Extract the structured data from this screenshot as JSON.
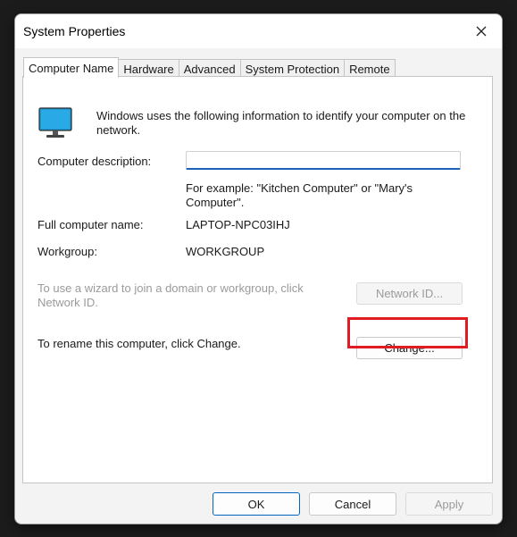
{
  "window": {
    "title": "System Properties"
  },
  "tabs": [
    {
      "label": "Computer Name",
      "active": true
    },
    {
      "label": "Hardware"
    },
    {
      "label": "Advanced"
    },
    {
      "label": "System Protection"
    },
    {
      "label": "Remote"
    }
  ],
  "panel": {
    "intro_text": "Windows uses the following information to identify your computer on the network.",
    "description_label": "Computer description:",
    "description_value": "",
    "example_text": "For example: \"Kitchen Computer\" or \"Mary's Computer\".",
    "full_name_label": "Full computer name:",
    "full_name_value": "LAPTOP-NPC03IHJ",
    "workgroup_label": "Workgroup:",
    "workgroup_value": "WORKGROUP",
    "wizard_text": "To use a wizard to join a domain or workgroup, click Network ID.",
    "network_id_button": "Network ID...",
    "rename_text": "To rename this computer, click Change.",
    "change_button": "Change..."
  },
  "footer": {
    "ok": "OK",
    "cancel": "Cancel",
    "apply": "Apply"
  },
  "icons": {
    "close": "close-icon",
    "computer": "monitor-icon"
  },
  "colors": {
    "accent": "#0067c0",
    "highlight": "#e11b22",
    "monitor": "#1e9ad6"
  }
}
